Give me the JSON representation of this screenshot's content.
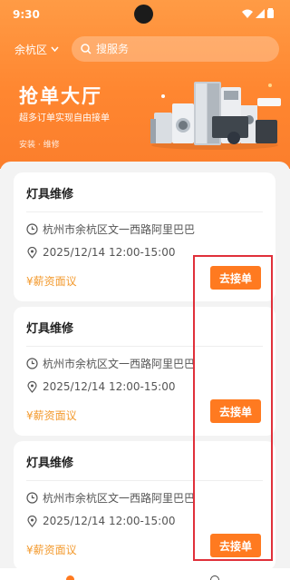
{
  "status_bar": {
    "time": "9:30"
  },
  "header": {
    "region": "余杭区",
    "search_placeholder": "搜服务",
    "hero_title": "抢单大厅",
    "hero_subtitle": "超多订单实现自由接单",
    "hero_tags": "安装 · 维修"
  },
  "orders": [
    {
      "title": "灯具维修",
      "address": "杭州市余杭区文一西路阿里巴巴",
      "datetime": "2025/12/14 12:00-15:00",
      "salary": "¥薪资面议",
      "action": "去接单"
    },
    {
      "title": "灯具维修",
      "address": "杭州市余杭区文一西路阿里巴巴",
      "datetime": "2025/12/14 12:00-15:00",
      "salary": "¥薪资面议",
      "action": "去接单"
    },
    {
      "title": "灯具维修",
      "address": "杭州市余杭区文一西路阿里巴巴",
      "datetime": "2025/12/14 12:00-15:00",
      "salary": "¥薪资面议",
      "action": "去接单"
    }
  ],
  "colors": {
    "brand": "#ff8630",
    "button": "#ff7a20",
    "salary": "#f39a2e",
    "annotation": "#e0303a"
  },
  "icons": [
    "signal-icon",
    "wifi-icon",
    "battery-icon",
    "chevron-down-icon",
    "search-icon",
    "clock-icon",
    "location-pin-icon"
  ]
}
